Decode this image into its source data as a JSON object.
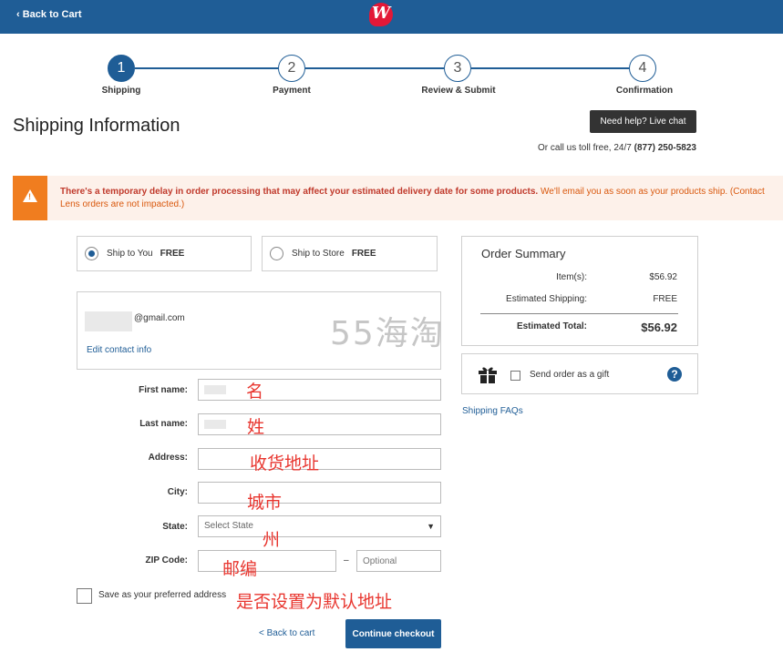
{
  "header": {
    "back_label": "Back to Cart",
    "logo_letter": "W"
  },
  "steps": [
    {
      "number": "1",
      "label": "Shipping"
    },
    {
      "number": "2",
      "label": "Payment"
    },
    {
      "number": "3",
      "label": "Review & Submit"
    },
    {
      "number": "4",
      "label": "Confirmation"
    }
  ],
  "page_title": "Shipping Information",
  "help": {
    "live_chat_label": "Need help? Live chat",
    "toll_free_text": "Or call us toll free, 24/7",
    "phone": "(877) 250-5823"
  },
  "alert": {
    "bold_text": "There's a temporary delay in order processing that may affect your estimated delivery date for some products.",
    "normal_text": "We'll email you as soon as your products ship. (Contact Lens orders are not impacted.)"
  },
  "shipping_options": [
    {
      "label": "Ship to You",
      "price": "FREE",
      "selected": true
    },
    {
      "label": "Ship to Store",
      "price": "FREE",
      "selected": false
    }
  ],
  "contact": {
    "email_domain": "@gmail.com",
    "edit_label": "Edit contact info"
  },
  "watermark": "55海淘",
  "form": {
    "first_name_label": "First name:",
    "last_name_label": "Last name:",
    "address_label": "Address:",
    "city_label": "City:",
    "state_label": "State:",
    "state_value": "Select State",
    "zip_label": "ZIP Code:",
    "zip_ext_placeholder": "Optional",
    "zip_dash": "–",
    "save_label": "Save as your preferred address"
  },
  "annotations": {
    "first_name": "名",
    "last_name": "姓",
    "address": "收货地址",
    "city": "城市",
    "state": "州",
    "zip": "邮编",
    "save": "是否设置为默认地址"
  },
  "actions": {
    "back_label": "< Back to cart",
    "continue_label": "Continue checkout"
  },
  "summary": {
    "title": "Order Summary",
    "items_label": "Item(s):",
    "items_value": "$56.92",
    "shipping_label": "Estimated Shipping:",
    "shipping_value": "FREE",
    "total_label": "Estimated Total:",
    "total_value": "$56.92"
  },
  "gift": {
    "label": "Send order as a gift",
    "help_glyph": "?"
  },
  "faq_label": "Shipping FAQs",
  "colors": {
    "brand": "#1f5d96",
    "alert_orange": "#f07d1f",
    "annotation_red": "#e8362f"
  }
}
